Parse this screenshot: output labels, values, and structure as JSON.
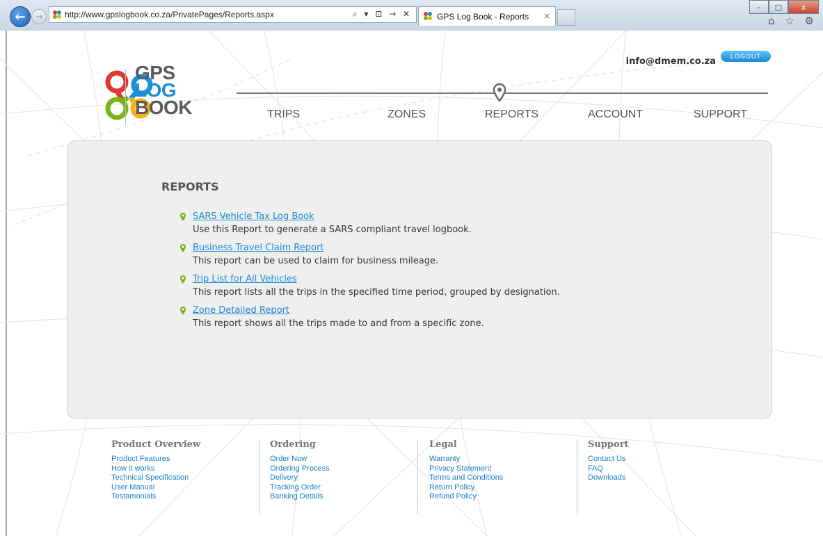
{
  "browser": {
    "url": "http://www.gpslogbook.co.za/PrivatePages/Reports.aspx",
    "tab_title": "GPS Log Book - Reports",
    "address_tools": "⌕ ▾ ⊡ → ✕",
    "tab_close": "×",
    "window_buttons": {
      "minimize": "–",
      "maximize": "□",
      "close": "x"
    },
    "right_icons": "⌂ ☆ ⚙"
  },
  "site": {
    "logo": {
      "line1": "GPS",
      "line2": "LOG",
      "line3": "BOOK"
    },
    "user_email": "info@dmem.co.za",
    "logout_label": "LOGOUT",
    "nav": [
      {
        "label": "TRIPS"
      },
      {
        "label": "ZONES"
      },
      {
        "label": "REPORTS",
        "active": true
      },
      {
        "label": "ACCOUNT"
      },
      {
        "label": "SUPPORT"
      }
    ]
  },
  "reports": {
    "title": "REPORTS",
    "items": [
      {
        "link": "SARS Vehicle Tax Log Book",
        "desc": "Use this Report to generate a SARS compliant travel logbook."
      },
      {
        "link": "Business Travel Claim Report",
        "desc": "This report can be used to claim for business mileage."
      },
      {
        "link": "Trip List for All Vehicles",
        "desc": "This report lists all the trips in the specified time period, grouped by designation."
      },
      {
        "link": "Zone Detailed Report",
        "desc": "This report shows all the trips made to and from a specific zone."
      }
    ]
  },
  "footer": {
    "columns": [
      {
        "heading": "Product Overview",
        "links": [
          "Product Features",
          "How it works",
          "Technical Specification",
          "User Manual",
          "Testamonials"
        ]
      },
      {
        "heading": "Ordering",
        "links": [
          "Order Now",
          "Ordering Process",
          "Delivery",
          "Tracking Order",
          "Banking Details"
        ]
      },
      {
        "heading": "Legal",
        "links": [
          "Warranty",
          "Privacy Statement",
          "Terms and Conditions",
          "Return Policy",
          "Refund Policy"
        ]
      },
      {
        "heading": "Support",
        "links": [
          "Contact Us",
          "FAQ",
          "Downloads"
        ]
      }
    ]
  },
  "colors": {
    "link": "#1a8ad6",
    "accent_blue": "#1a8fd6",
    "pin_green": "#7ab317",
    "text": "#333333"
  }
}
